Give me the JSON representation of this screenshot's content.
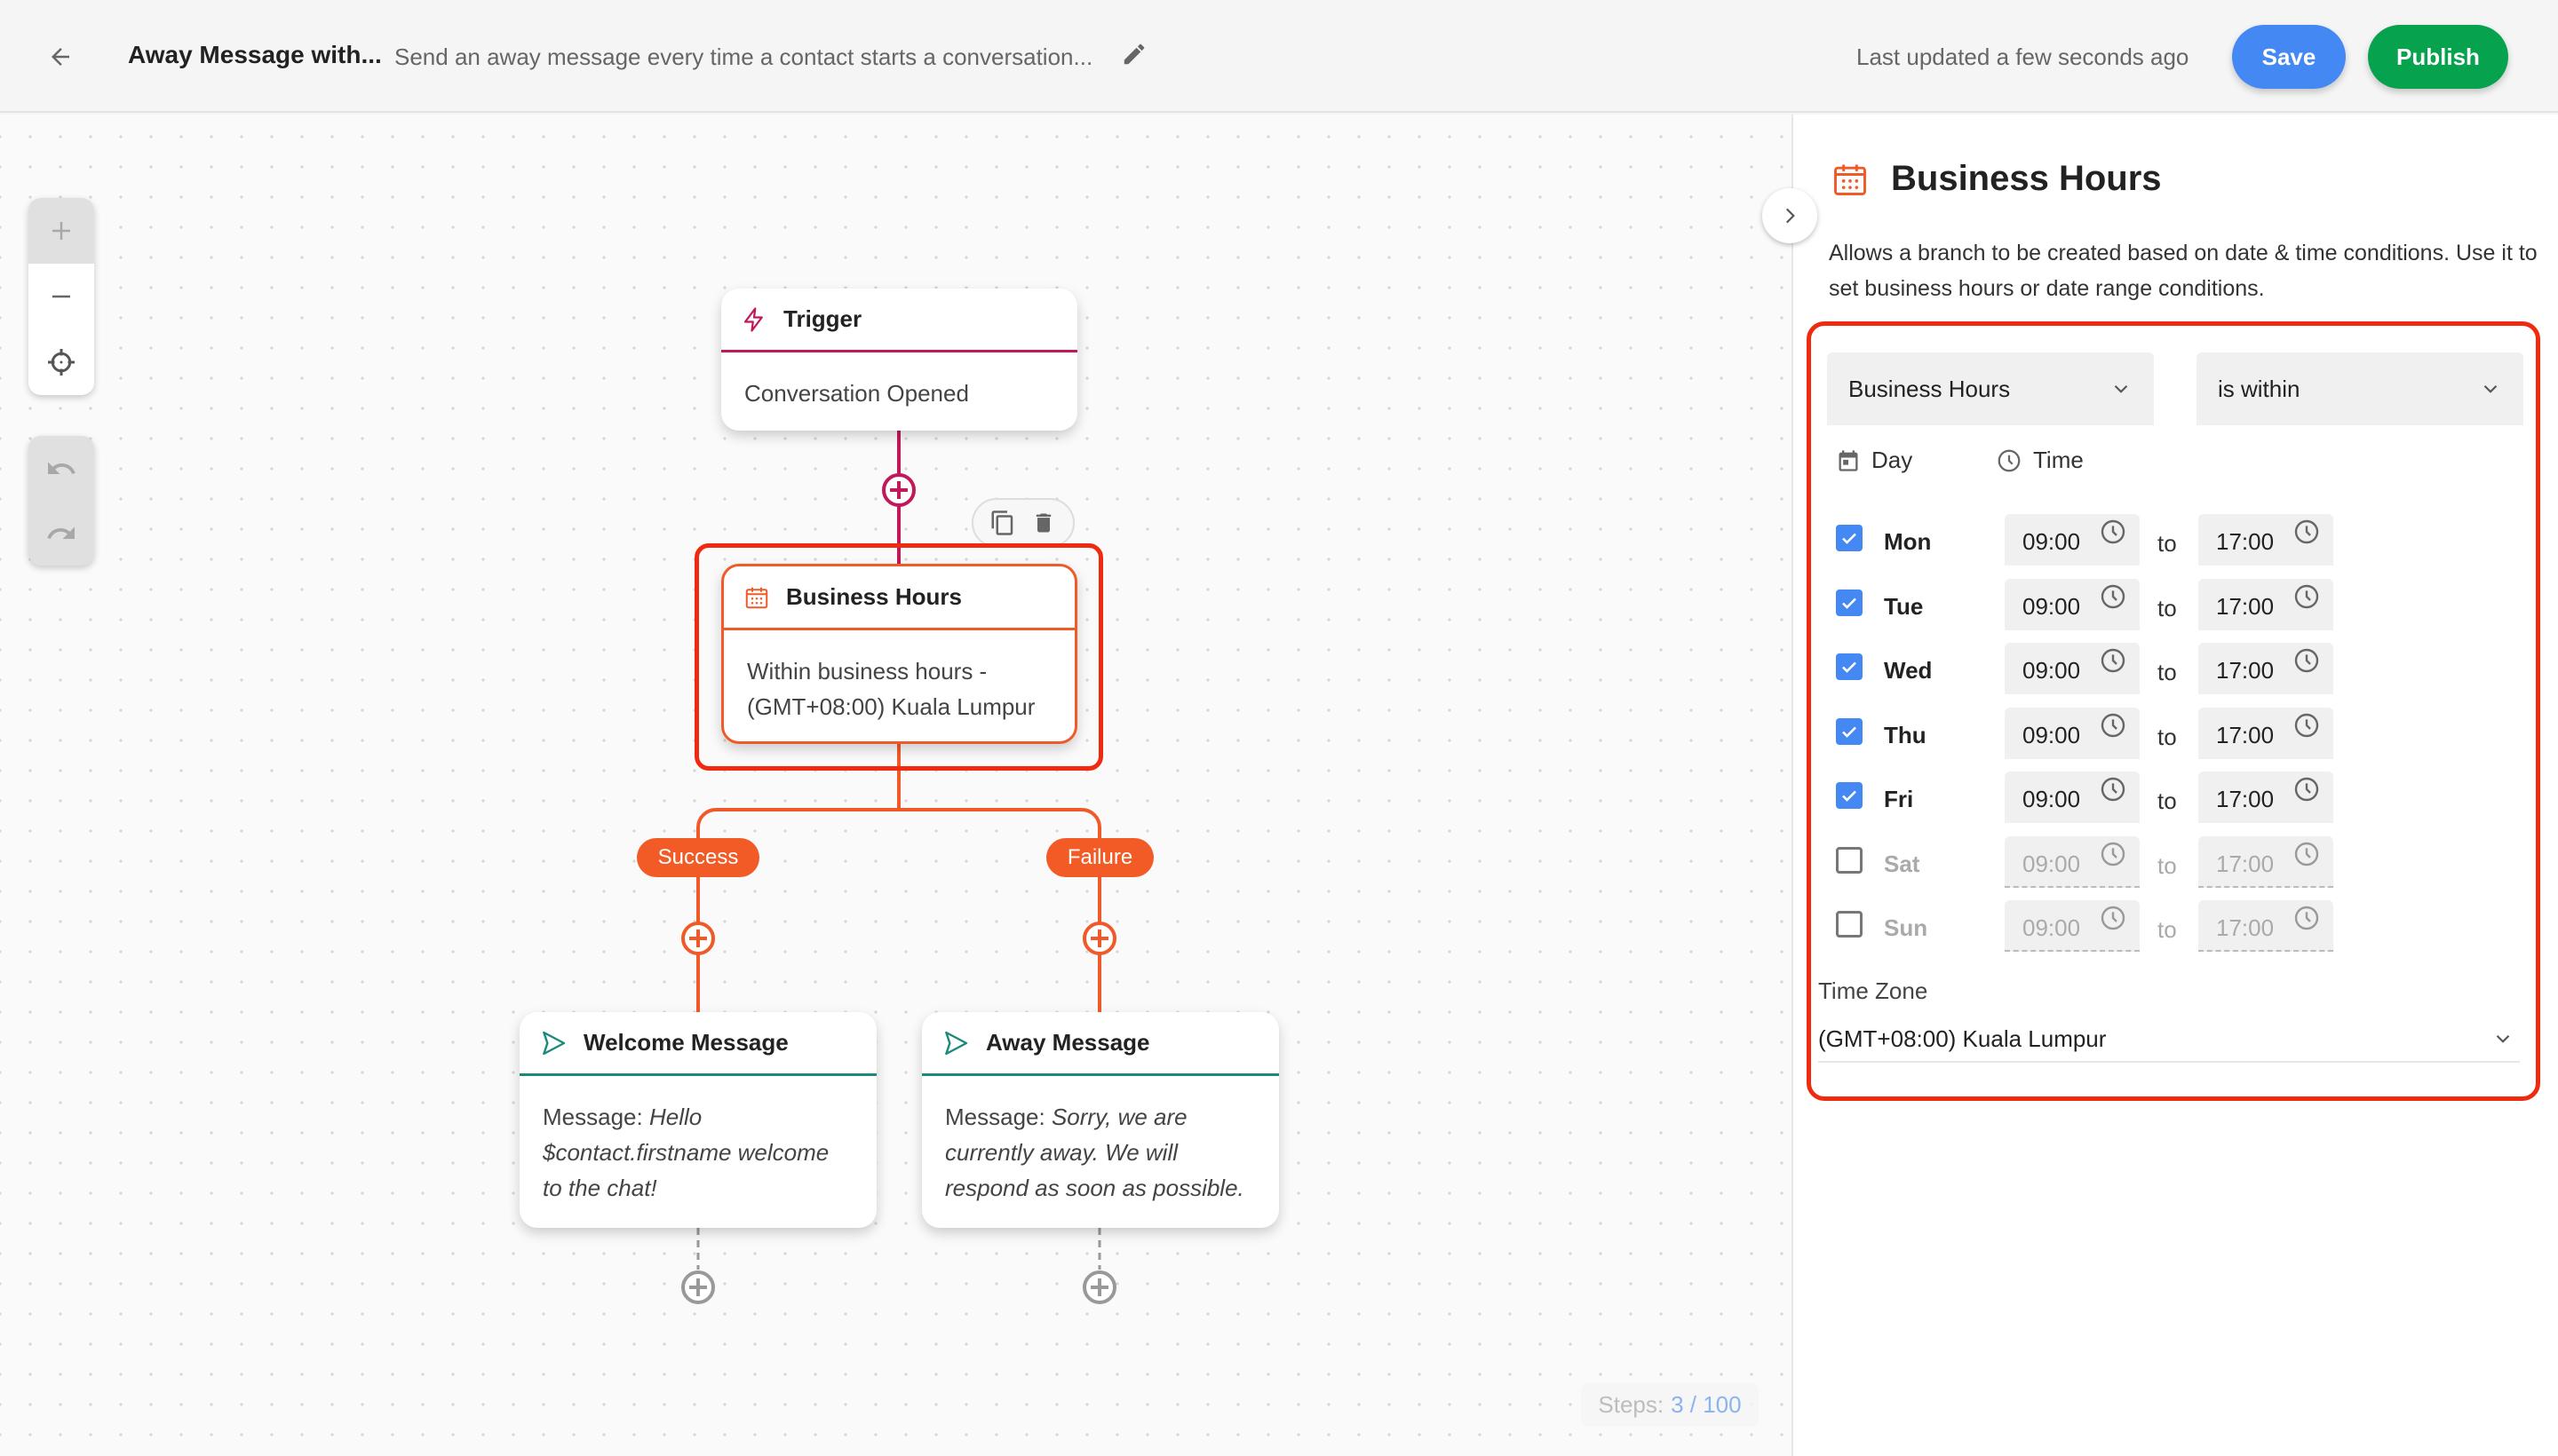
{
  "header": {
    "title": "Away Message with...",
    "description": "Send an away message every time a contact starts a conversation...",
    "last_updated": "Last updated a few seconds ago",
    "save_label": "Save",
    "publish_label": "Publish"
  },
  "canvas": {
    "nodes": {
      "trigger": {
        "title": "Trigger",
        "body": "Conversation Opened",
        "icon": "lightning-icon"
      },
      "business_hours": {
        "title": "Business Hours",
        "body_line1": "Within business hours -",
        "body_line2": "(GMT+08:00) Kuala Lumpur",
        "icon": "calendar-icon"
      },
      "welcome": {
        "title": "Welcome Message",
        "prefix": "Message: ",
        "message": "Hello $contact.firstname welcome to the chat!",
        "icon": "send-icon"
      },
      "away": {
        "title": "Away Message",
        "prefix": "Message: ",
        "message": "Sorry, we are currently away. We will respond as soon as possible.",
        "icon": "send-icon"
      }
    },
    "branches": {
      "success": "Success",
      "failure": "Failure"
    },
    "steps": {
      "label": "Steps:",
      "value": "3 / 100"
    },
    "colors": {
      "trigger": "#c2185b",
      "condition": "#f05a28",
      "message": "#1a8a7a",
      "highlight": "#f02a0e"
    }
  },
  "panel": {
    "title": "Business Hours",
    "description": "Allows a branch to be created based on date & time conditions. Use it to set business hours or date range conditions.",
    "field_select": "Business Hours",
    "operator_select": "is within",
    "col_day": "Day",
    "col_time": "Time",
    "to_word": "to",
    "days": [
      {
        "name": "Mon",
        "checked": true,
        "from": "09:00",
        "to": "17:00"
      },
      {
        "name": "Tue",
        "checked": true,
        "from": "09:00",
        "to": "17:00"
      },
      {
        "name": "Wed",
        "checked": true,
        "from": "09:00",
        "to": "17:00"
      },
      {
        "name": "Thu",
        "checked": true,
        "from": "09:00",
        "to": "17:00"
      },
      {
        "name": "Fri",
        "checked": true,
        "from": "09:00",
        "to": "17:00"
      },
      {
        "name": "Sat",
        "checked": false,
        "from": "09:00",
        "to": "17:00"
      },
      {
        "name": "Sun",
        "checked": false,
        "from": "09:00",
        "to": "17:00"
      }
    ],
    "timezone_label": "Time Zone",
    "timezone_value": "(GMT+08:00) Kuala Lumpur"
  }
}
